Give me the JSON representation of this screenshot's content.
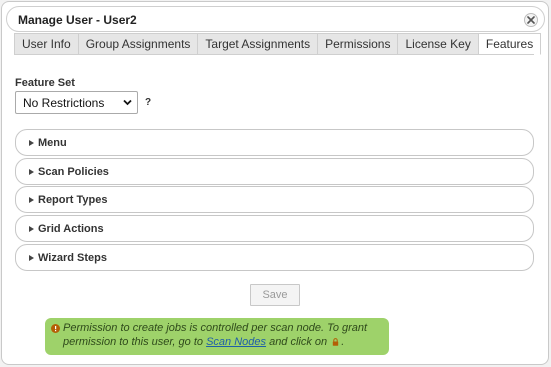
{
  "dialog": {
    "title": "Manage User - User2",
    "close_icon": "close-icon"
  },
  "tabs": [
    {
      "label": "User Info",
      "active": false
    },
    {
      "label": "Group Assignments",
      "active": false
    },
    {
      "label": "Target Assignments",
      "active": false
    },
    {
      "label": "Permissions",
      "active": false
    },
    {
      "label": "License Key",
      "active": false
    },
    {
      "label": "Features",
      "active": true
    }
  ],
  "feature_set": {
    "label": "Feature Set",
    "selected": "No Restrictions",
    "help": "?"
  },
  "sections": [
    {
      "label": "Menu"
    },
    {
      "label": "Scan Policies"
    },
    {
      "label": "Report Types"
    },
    {
      "label": "Grid Actions"
    },
    {
      "label": "Wizard Steps"
    }
  ],
  "save_label": "Save",
  "notice": {
    "text_1": "Permission to create jobs is controlled per scan node. To grant permission to this user, go to ",
    "link": "Scan Nodes",
    "text_2": " and click on ",
    "text_3": ".",
    "icon": "info-icon",
    "inline_icon": "lock-icon",
    "color": "#9ed26a"
  }
}
